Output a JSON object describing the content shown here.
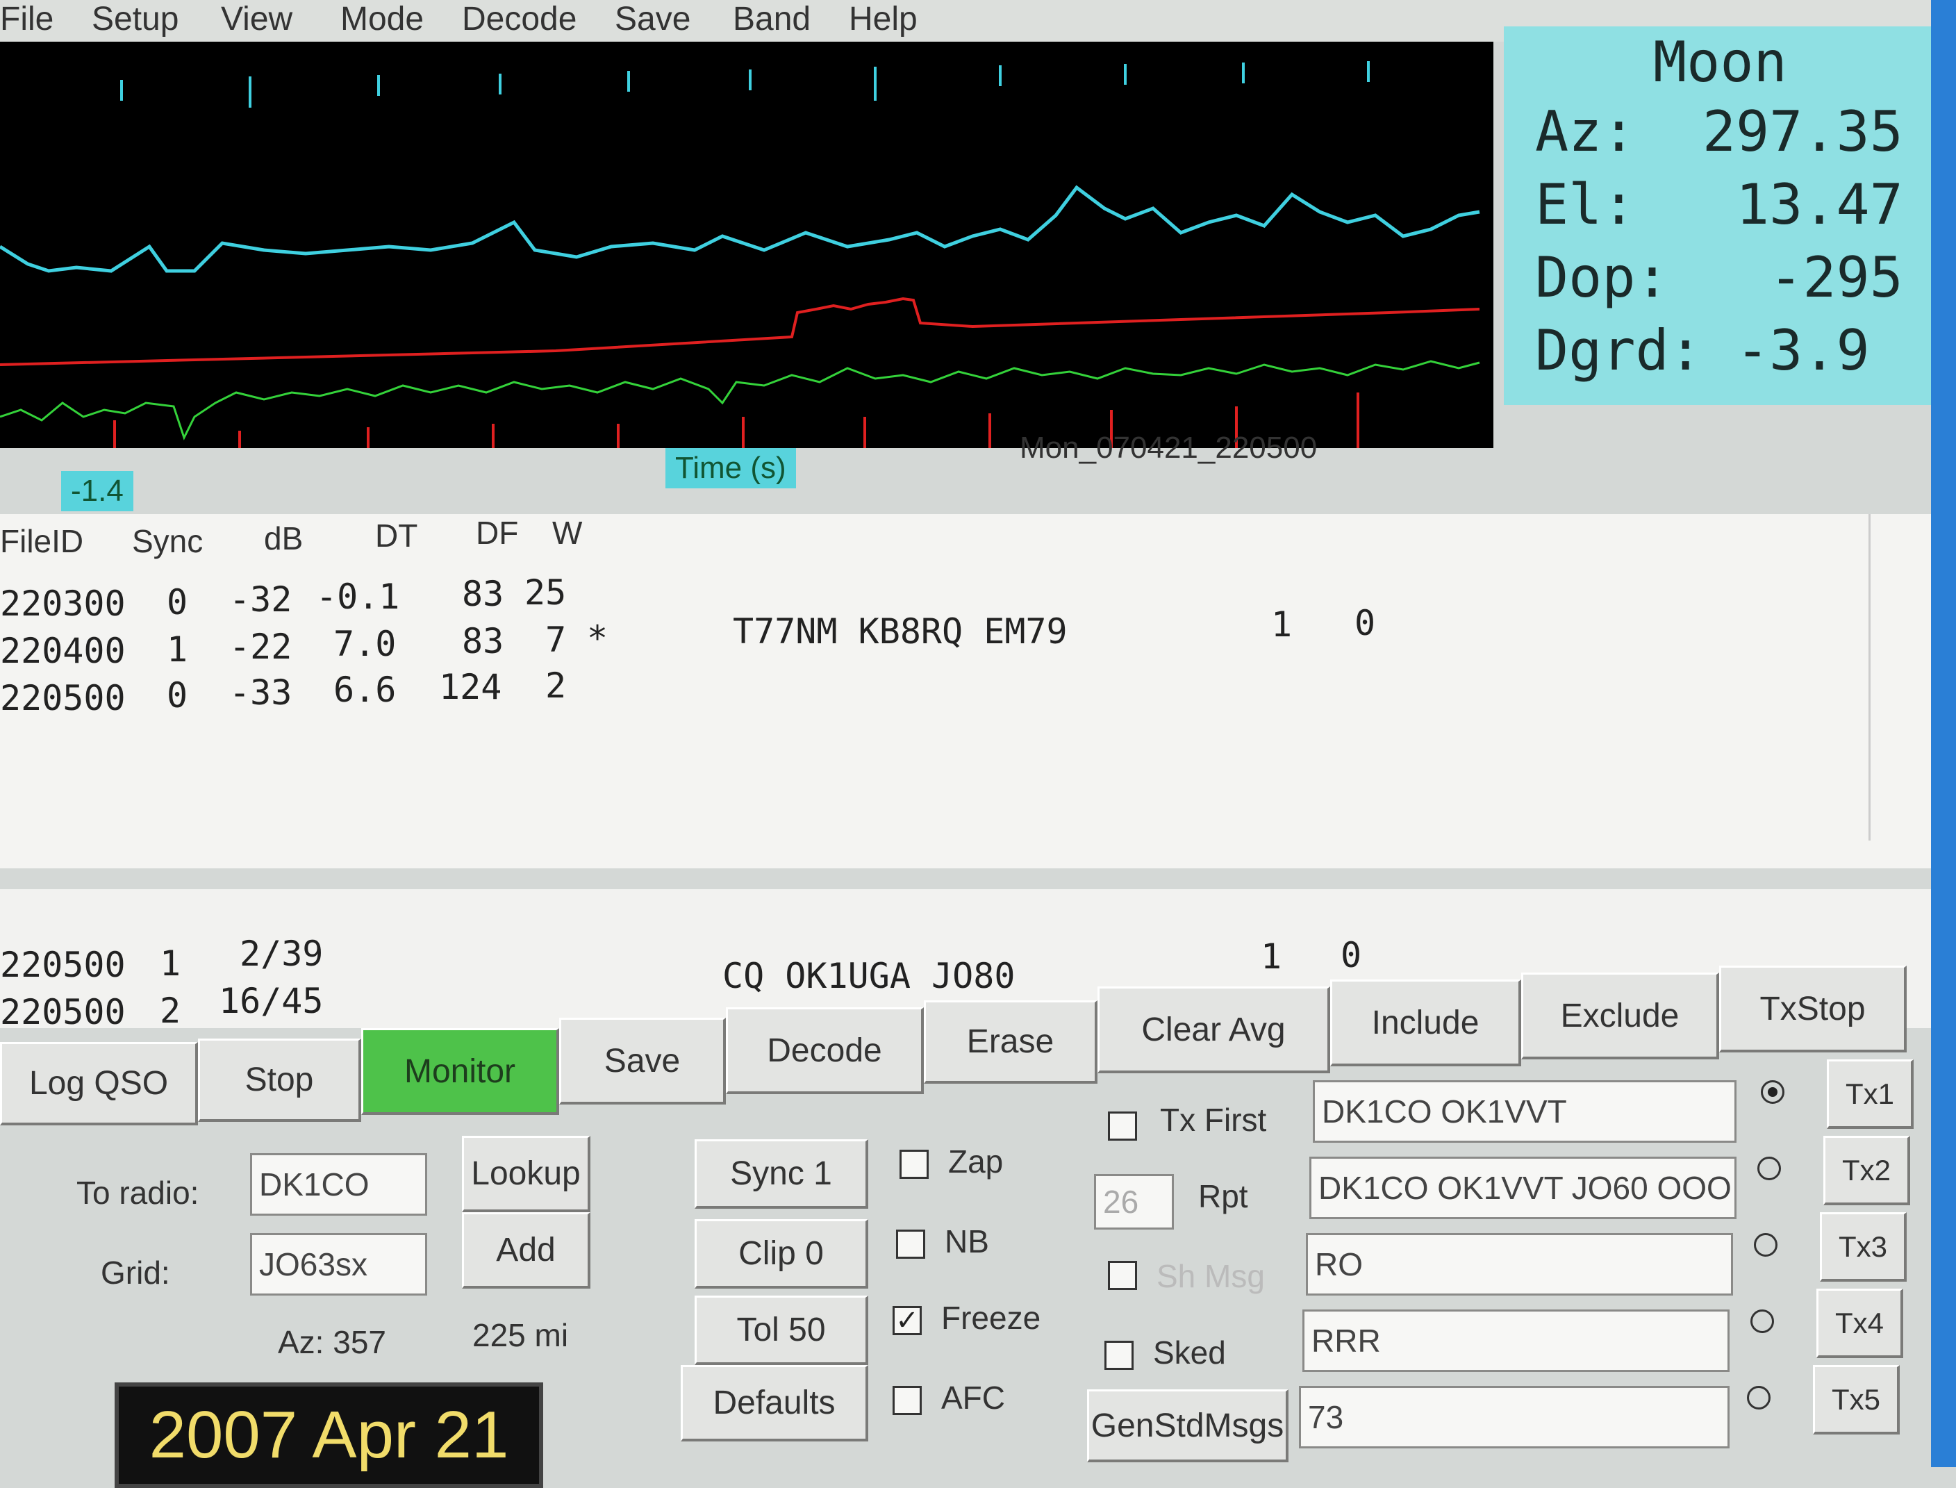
{
  "menu": [
    "File",
    "Setup",
    "View",
    "Mode",
    "Decode",
    "Save",
    "Band",
    "Help"
  ],
  "moon": {
    "title": "Moon",
    "az": "Az:  297.35",
    "el": "El:   13.47",
    "dop": "Dop:   -295",
    "dgrd": "Dgrd: -3.9"
  },
  "plot": {
    "dt_value": "-1.4",
    "xlabel": "Time (s)",
    "filename": "Mon_070421_220500",
    "colors": {
      "cyan": "#3fd0e0",
      "red": "#e02020",
      "green": "#34d23a"
    }
  },
  "decoded": {
    "headers": [
      "FileID",
      "Sync",
      "dB",
      "DT",
      "DF",
      "W"
    ],
    "rows": [
      {
        "fileid": "220300",
        "sync": "0",
        "db": "-32",
        "dt": "-0.1",
        "df": "83",
        "w": "25",
        "flag": "",
        "msg": "",
        "n1": "",
        "n2": ""
      },
      {
        "fileid": "220400",
        "sync": "1",
        "db": "-22",
        "dt": "7.0",
        "df": "83",
        "w": "7",
        "flag": "*",
        "msg": "T77NM KB8RQ EM79",
        "n1": "1",
        "n2": "0"
      },
      {
        "fileid": "220500",
        "sync": "0",
        "db": "-33",
        "dt": "6.6",
        "df": "124",
        "w": "2",
        "flag": "",
        "msg": "",
        "n1": "",
        "n2": ""
      }
    ]
  },
  "average": {
    "rows": [
      {
        "fileid": "220500",
        "a": "1",
        "b": "2/39"
      },
      {
        "fileid": "220500",
        "a": "2",
        "b": "16/45"
      }
    ],
    "msg": "CQ OK1UGA JO80",
    "n1": "1",
    "n2": "0"
  },
  "buttons_row1": [
    "Clear Avg",
    "Include",
    "Exclude",
    "TxStop"
  ],
  "buttons_row2": [
    "Log QSO",
    "Stop",
    "Monitor",
    "Save",
    "Decode",
    "Erase"
  ],
  "left_panel": {
    "to_radio_label": "To radio:",
    "to_radio_value": "DK1CO",
    "grid_label": "Grid:",
    "grid_value": "JO63sx",
    "lookup": "Lookup",
    "add": "Add",
    "az": "Az: 357",
    "distance": "225 mi",
    "date": "2007 Apr 21"
  },
  "mid_panel": {
    "sync": "Sync  1",
    "clip": "Clip  0",
    "tol": "Tol   50",
    "defaults": "Defaults",
    "zap": "Zap",
    "nb": "NB",
    "freeze": "Freeze",
    "afc": "AFC",
    "freeze_checked": true
  },
  "right_panel": {
    "tx_first": "Tx First",
    "rpt_value": "26",
    "rpt_label": "Rpt",
    "sh_msg": "Sh Msg",
    "sked": "Sked",
    "genstd": "GenStdMsgs",
    "tx_msgs": [
      "DK1CO OK1VVT",
      "DK1CO OK1VVT JO60 OOO",
      "RO",
      "RRR",
      "73"
    ],
    "tx_buttons": [
      "Tx1",
      "Tx2",
      "Tx3",
      "Tx4",
      "Tx5"
    ],
    "selected_tx": 0
  }
}
